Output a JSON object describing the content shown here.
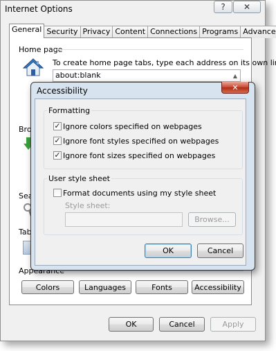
{
  "window": {
    "title": "Internet Options",
    "help_label": "?",
    "close_label": "✕"
  },
  "tabs": [
    "General",
    "Security",
    "Privacy",
    "Content",
    "Connections",
    "Programs",
    "Advanced"
  ],
  "general": {
    "home_page": {
      "heading": "Home page",
      "description": "To create home page tabs, type each address on its own line.",
      "address": "about:blank"
    },
    "browsing_history_partial": "Brow",
    "search_partial": "Sea",
    "tabs_partial": "Tab",
    "appearance": {
      "heading": "Appearance",
      "buttons": {
        "colors": "Colors",
        "languages": "Languages",
        "fonts": "Fonts",
        "accessibility": "Accessibility"
      }
    }
  },
  "footer": {
    "ok": "OK",
    "cancel": "Cancel",
    "apply": "Apply"
  },
  "dialog": {
    "title": "Accessibility",
    "close_label": "✕",
    "formatting": {
      "legend": "Formatting",
      "options": [
        {
          "label": "Ignore colors specified on webpages",
          "checked": true
        },
        {
          "label": "Ignore font styles specified on webpages",
          "checked": true
        },
        {
          "label": "Ignore font sizes specified on webpages",
          "checked": true
        }
      ]
    },
    "user_style_sheet": {
      "legend": "User style sheet",
      "option": {
        "label": "Format documents using my style sheet",
        "checked": false
      },
      "field_label": "Style sheet:",
      "field_value": "",
      "browse": "Browse..."
    },
    "ok": "OK",
    "cancel": "Cancel"
  },
  "colors": {
    "house_roof": "#3a78c2",
    "house_wall": "#e8eef6",
    "arrow_green": "#3aa23a",
    "close_red": "#c8462f"
  }
}
